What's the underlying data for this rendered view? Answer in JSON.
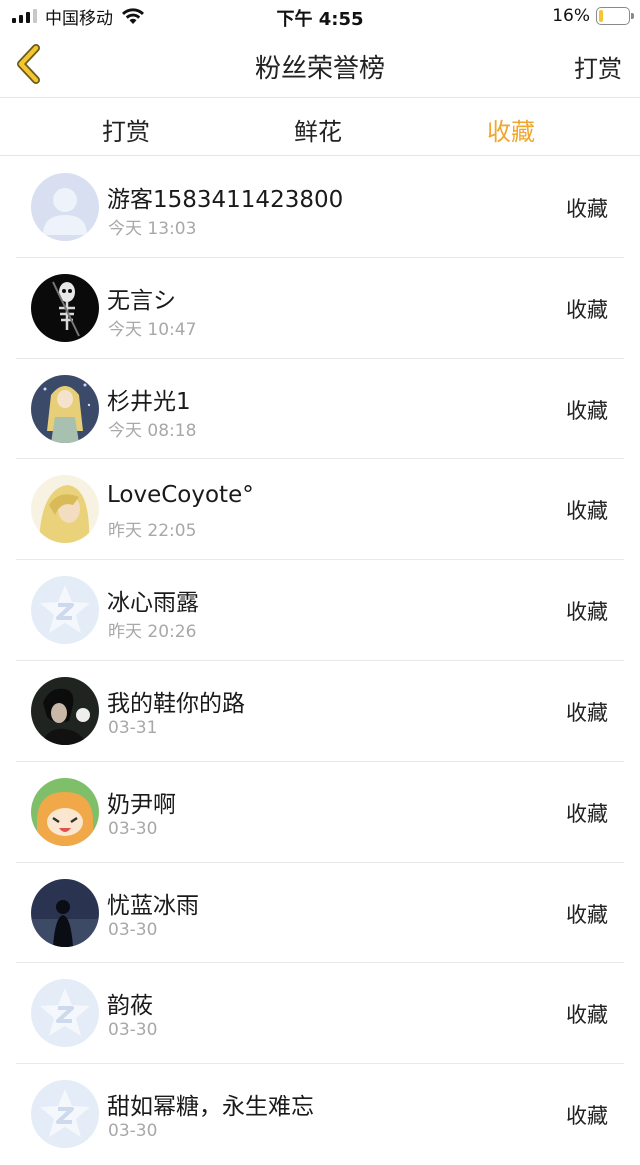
{
  "status_bar": {
    "carrier": "中国移动",
    "time": "下午 4:55",
    "battery_percent": "16%",
    "battery_level": 0.16,
    "battery_color": "#f3c52e"
  },
  "nav": {
    "back_icon": "chevron-left-icon",
    "title": "粉丝荣誉榜",
    "action_label": "打赏"
  },
  "tabs": [
    {
      "label": "打赏",
      "active": false
    },
    {
      "label": "鲜花",
      "active": false
    },
    {
      "label": "收藏",
      "active": true
    }
  ],
  "accent_color": "#f0a630",
  "fans": [
    {
      "name": "游客1583411423800",
      "time": "今天 13:03",
      "action": "收藏",
      "avatar": "default-user"
    },
    {
      "name": "无言シ",
      "time": "今天 10:47",
      "action": "收藏",
      "avatar": "skeleton-dark"
    },
    {
      "name": "杉井光1",
      "time": "今天 08:18",
      "action": "收藏",
      "avatar": "anime-blonde-girl"
    },
    {
      "name": "LoveCoyote°",
      "time": "昨天 22:05",
      "action": "收藏",
      "avatar": "anime-blonde-boy"
    },
    {
      "name": "冰心雨露",
      "time": "昨天 20:26",
      "action": "收藏",
      "avatar": "default-star"
    },
    {
      "name": "我的鞋你的路",
      "time": "03-31",
      "action": "收藏",
      "avatar": "dark-portrait"
    },
    {
      "name": "奶尹啊",
      "time": "03-30",
      "action": "收藏",
      "avatar": "anime-orange-hair"
    },
    {
      "name": "忧蓝冰雨",
      "time": "03-30",
      "action": "收藏",
      "avatar": "silhouette-night"
    },
    {
      "name": "韵莜",
      "time": "03-30",
      "action": "收藏",
      "avatar": "default-star"
    },
    {
      "name": "甜如幂糖，永生难忘",
      "time": "03-30",
      "action": "收藏",
      "avatar": "default-star"
    }
  ]
}
